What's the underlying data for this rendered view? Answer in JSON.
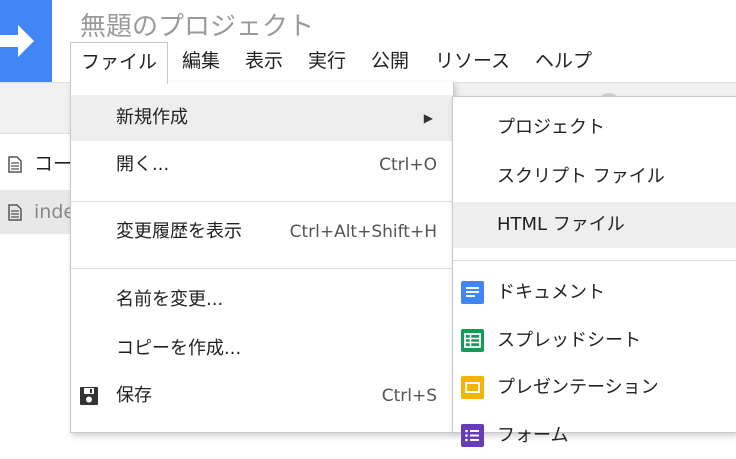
{
  "app": {
    "title": "無題のプロジェクト"
  },
  "menubar": {
    "items": [
      "ファイル",
      "編集",
      "表示",
      "実行",
      "公開",
      "リソース",
      "ヘルプ"
    ]
  },
  "files": [
    "コード.gs",
    "index.html"
  ],
  "file_menu": {
    "new": "新規作成",
    "open": "開く...",
    "open_shortcut": "Ctrl+O",
    "history": "変更履歴を表示",
    "history_shortcut": "Ctrl+Alt+Shift+H",
    "rename": "名前を変更...",
    "copy": "コピーを作成...",
    "save": "保存",
    "save_shortcut": "Ctrl+S"
  },
  "new_submenu": {
    "project": "プロジェクト",
    "script_file": "スクリプト ファイル",
    "html_file": "HTML ファイル",
    "document": "ドキュメント",
    "spreadsheet": "スプレッドシート",
    "presentation": "プレゼンテーション",
    "form": "フォーム"
  },
  "colors": {
    "brand": "#4285f4",
    "docs": "#4285f4",
    "sheets": "#0f9d58",
    "slides": "#f4b400",
    "forms": "#673ab7"
  }
}
